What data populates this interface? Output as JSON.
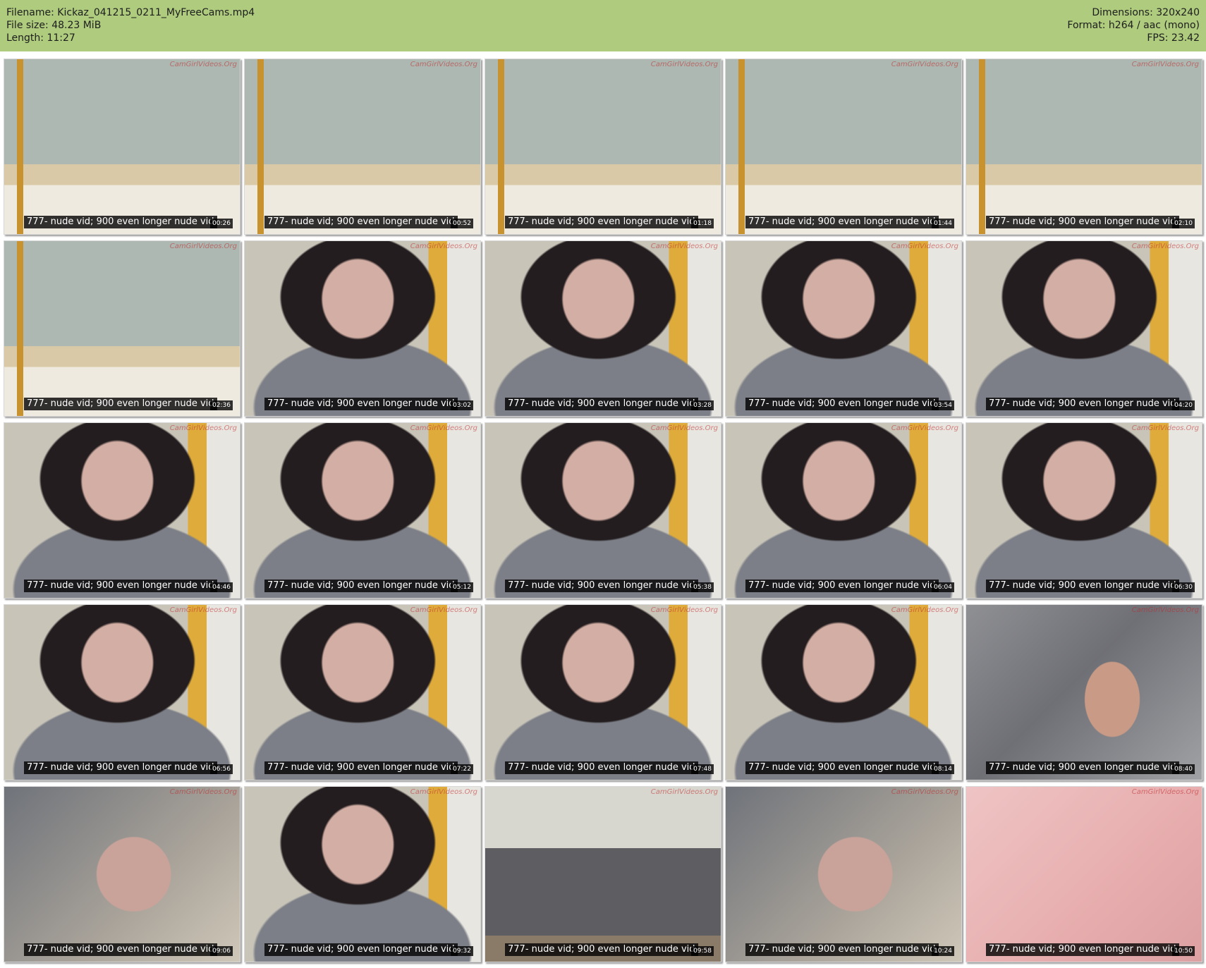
{
  "header": {
    "filename": "Filename: Kickaz_041215_0211_MyFreeCams.mp4",
    "file_size": "File size: 48.23 MiB",
    "length": "Length: 11:27",
    "dimensions": "Dimensions: 320x240",
    "format": "Format: h264 / aac (mono)",
    "fps": "FPS: 23.42",
    "background_color": "#aecb7e"
  },
  "caption": "777- nude vid; 900 even longer nude vid",
  "watermark": "CamGirlVideos.Org",
  "thumbnails": [
    {
      "time": "00:26",
      "scene": "room"
    },
    {
      "time": "00:52",
      "scene": "room"
    },
    {
      "time": "01:18",
      "scene": "room"
    },
    {
      "time": "01:44",
      "scene": "room"
    },
    {
      "time": "02:10",
      "scene": "room"
    },
    {
      "time": "02:36",
      "scene": "room"
    },
    {
      "time": "03:02",
      "scene": "person"
    },
    {
      "time": "03:28",
      "scene": "person"
    },
    {
      "time": "03:54",
      "scene": "person"
    },
    {
      "time": "04:20",
      "scene": "person"
    },
    {
      "time": "04:46",
      "scene": "person"
    },
    {
      "time": "05:12",
      "scene": "person"
    },
    {
      "time": "05:38",
      "scene": "person"
    },
    {
      "time": "06:04",
      "scene": "person"
    },
    {
      "time": "06:30",
      "scene": "person"
    },
    {
      "time": "06:56",
      "scene": "person"
    },
    {
      "time": "07:22",
      "scene": "person"
    },
    {
      "time": "07:48",
      "scene": "person"
    },
    {
      "time": "08:14",
      "scene": "person"
    },
    {
      "time": "08:40",
      "scene": "robe"
    },
    {
      "time": "09:06",
      "scene": "close"
    },
    {
      "time": "09:32",
      "scene": "person"
    },
    {
      "time": "09:58",
      "scene": "bath"
    },
    {
      "time": "10:24",
      "scene": "close"
    },
    {
      "time": "10:50",
      "scene": "pink"
    }
  ]
}
